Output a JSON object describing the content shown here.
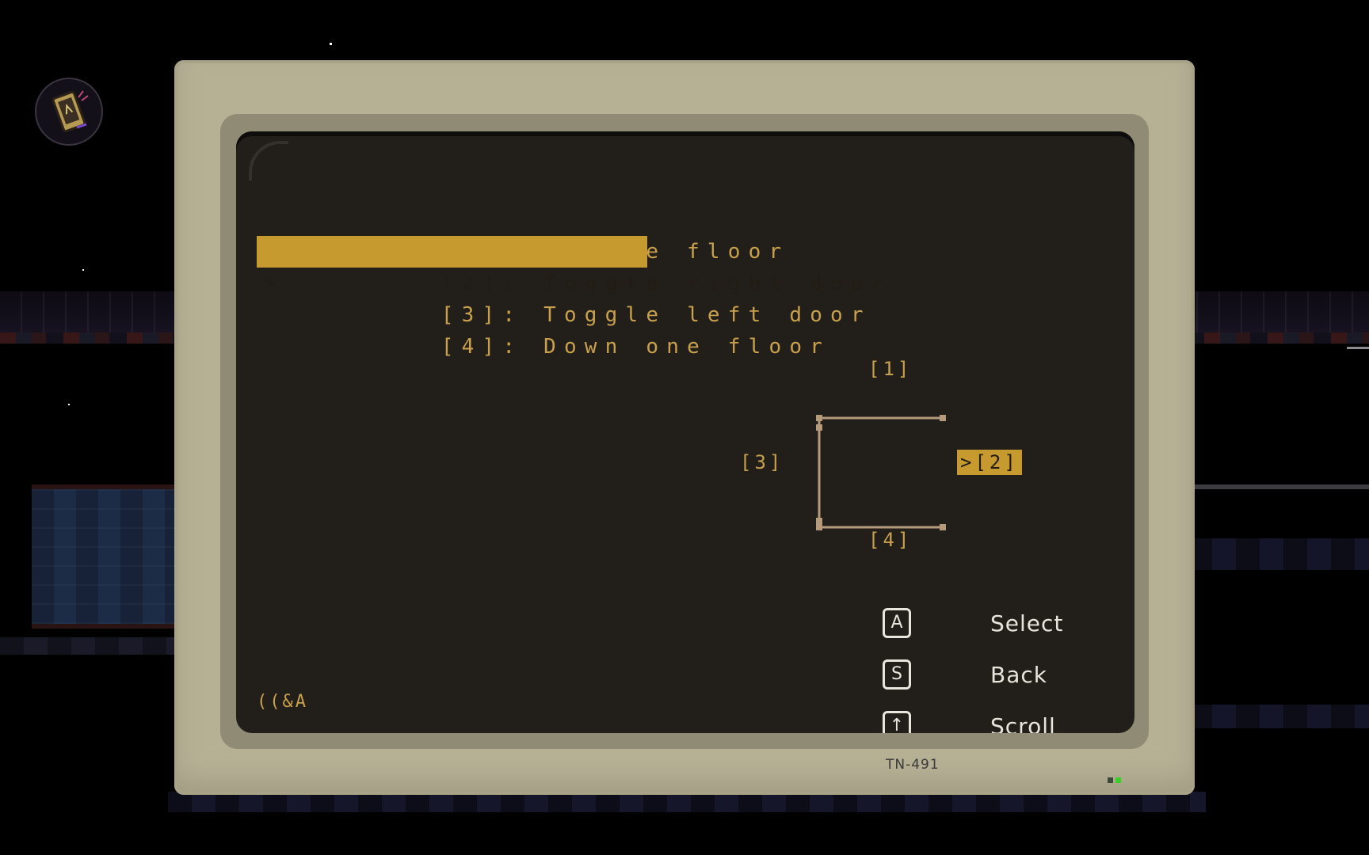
{
  "hud": {
    "badge_icon": "phone-device-icon"
  },
  "terminal": {
    "menu": [
      {
        "label": "[1]: Up one floor",
        "selected": false
      },
      {
        "label": "[2]: Toggle right door",
        "selected": true
      },
      {
        "label": "[3]: Toggle left door",
        "selected": false
      },
      {
        "label": "[4]: Down one floor",
        "selected": false
      }
    ],
    "selection_caret": ">",
    "map": {
      "top": "[1]",
      "right": ">[2]",
      "left": "[3]",
      "bottom": "[4]",
      "selected_node": "[2]"
    },
    "controls": [
      {
        "key": "A",
        "action": "Select"
      },
      {
        "key": "S",
        "action": "Back"
      },
      {
        "key": "↑",
        "action": "Scroll"
      }
    ],
    "brand": "((&A"
  },
  "monitor": {
    "model": "TN-491"
  },
  "colors": {
    "screen_bg": "#221f1b",
    "text_amber": "#c9a04b",
    "highlight": "#c69a2f",
    "bezel": "#b6b095",
    "diagram_line": "#b59a7c"
  }
}
